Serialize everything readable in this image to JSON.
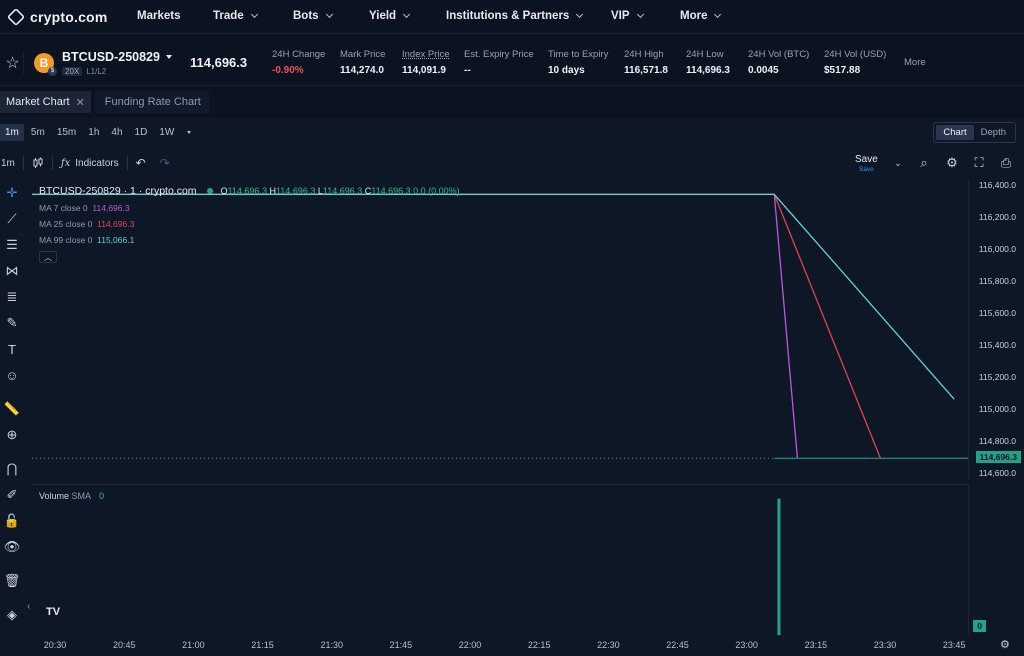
{
  "header": {
    "logo_text": "crypto.com",
    "nav": [
      {
        "label": "Markets",
        "has_menu": false
      },
      {
        "label": "Trade",
        "has_menu": true
      },
      {
        "label": "Bots",
        "has_menu": true
      },
      {
        "label": "Yield",
        "has_menu": true
      },
      {
        "label": "Institutions & Partners",
        "has_menu": true
      },
      {
        "label": "VIP",
        "has_menu": true
      },
      {
        "label": "More",
        "has_menu": true
      }
    ]
  },
  "ticker": {
    "coin_letter": "B",
    "symbol": "BTCUSD-250829",
    "leverage": "20X",
    "levels": "L1/L2",
    "last_price": "114,696.3",
    "stats": [
      {
        "label": "24H Change",
        "value": "-0.90%",
        "tone": "red"
      },
      {
        "label": "Mark Price",
        "value": "114,274.0",
        "tone": "normal"
      },
      {
        "label": "Index Price",
        "value": "114,091.9",
        "tone": "normal",
        "underline": true
      },
      {
        "label": "Est. Expiry Price",
        "value": "--",
        "tone": "normal"
      },
      {
        "label": "Time to Expiry",
        "value": "10 days",
        "tone": "normal"
      },
      {
        "label": "24H High",
        "value": "116,571.8",
        "tone": "normal"
      },
      {
        "label": "24H Low",
        "value": "114,696.3",
        "tone": "normal"
      },
      {
        "label": "24H Vol (BTC)",
        "value": "0.0045",
        "tone": "normal"
      },
      {
        "label": "24H Vol (USD)",
        "value": "$517.88",
        "tone": "normal"
      }
    ],
    "more": "More"
  },
  "tabs": [
    {
      "label": "Market Chart",
      "active": true,
      "closable": true
    },
    {
      "label": "Funding Rate Chart",
      "active": false,
      "closable": false
    }
  ],
  "chart_toolbar": {
    "intervals": [
      "1m",
      "5m",
      "15m",
      "1h",
      "4h",
      "1D",
      "1W"
    ],
    "active_interval": "1m",
    "view_modes": [
      "Chart",
      "Depth"
    ],
    "active_view": "Chart",
    "interval_short": "1m",
    "indicators_label": "Indicators",
    "save_label": "Save",
    "save_sub": "Save"
  },
  "legend": {
    "title": "BTCUSD-250829 · 1 · crypto.com",
    "ohlc": {
      "o": "114,696.3",
      "h": "114,696.3",
      "l": "114,696.3",
      "c": "114,696.3",
      "change": "0.0 (0.00%)"
    },
    "ma": [
      {
        "label": "MA 7 close 0",
        "value": "114,696.3",
        "color": "#c154e0"
      },
      {
        "label": "MA 25 close 0",
        "value": "114,696.3",
        "color": "#e0434d"
      },
      {
        "label": "MA 99 close 0",
        "value": "115,066.1",
        "color": "#5fd3c9"
      }
    ]
  },
  "volume_legend": {
    "label": "Volume",
    "sma": "SMA",
    "value": "0"
  },
  "volume_last": "0",
  "chart_data": {
    "type": "line",
    "price_axis": {
      "ticks": [
        "116,400.0",
        "116,200.0",
        "116,000.0",
        "115,800.0",
        "115,600.0",
        "115,400.0",
        "115,200.0",
        "115,000.0",
        "114,800.0",
        "114,600.0"
      ],
      "ylim": [
        114560,
        116440
      ],
      "last_value": 114696.3,
      "last_label": "114,696.3"
    },
    "time_axis": {
      "ticks": [
        "20:30",
        "20:45",
        "21:00",
        "21:15",
        "21:30",
        "21:45",
        "22:00",
        "22:15",
        "22:30",
        "22:45",
        "23:00",
        "23:15",
        "23:30",
        "23:45"
      ],
      "xlim_minutes": [
        1225,
        1428
      ]
    },
    "series": [
      {
        "name": "MA 7",
        "color": "#c154e0",
        "points": [
          [
            1225,
            116350
          ],
          [
            1386,
            116350
          ],
          [
            1391,
            114696.3
          ]
        ]
      },
      {
        "name": "MA 25",
        "color": "#e0434d",
        "points": [
          [
            1225,
            116350
          ],
          [
            1386,
            116350
          ],
          [
            1409,
            114696.3
          ]
        ]
      },
      {
        "name": "MA 99",
        "color": "#5fd3c9",
        "points": [
          [
            1225,
            116350
          ],
          [
            1386,
            116350
          ],
          [
            1425,
            115066.1
          ]
        ]
      },
      {
        "name": "close",
        "color": "#21a38a",
        "points": [
          [
            1386,
            114696.3
          ],
          [
            1428,
            114696.3
          ]
        ]
      }
    ],
    "volume": [
      {
        "t": 1387,
        "v": 1
      }
    ],
    "volume_ylim": [
      0,
      1.1
    ]
  }
}
